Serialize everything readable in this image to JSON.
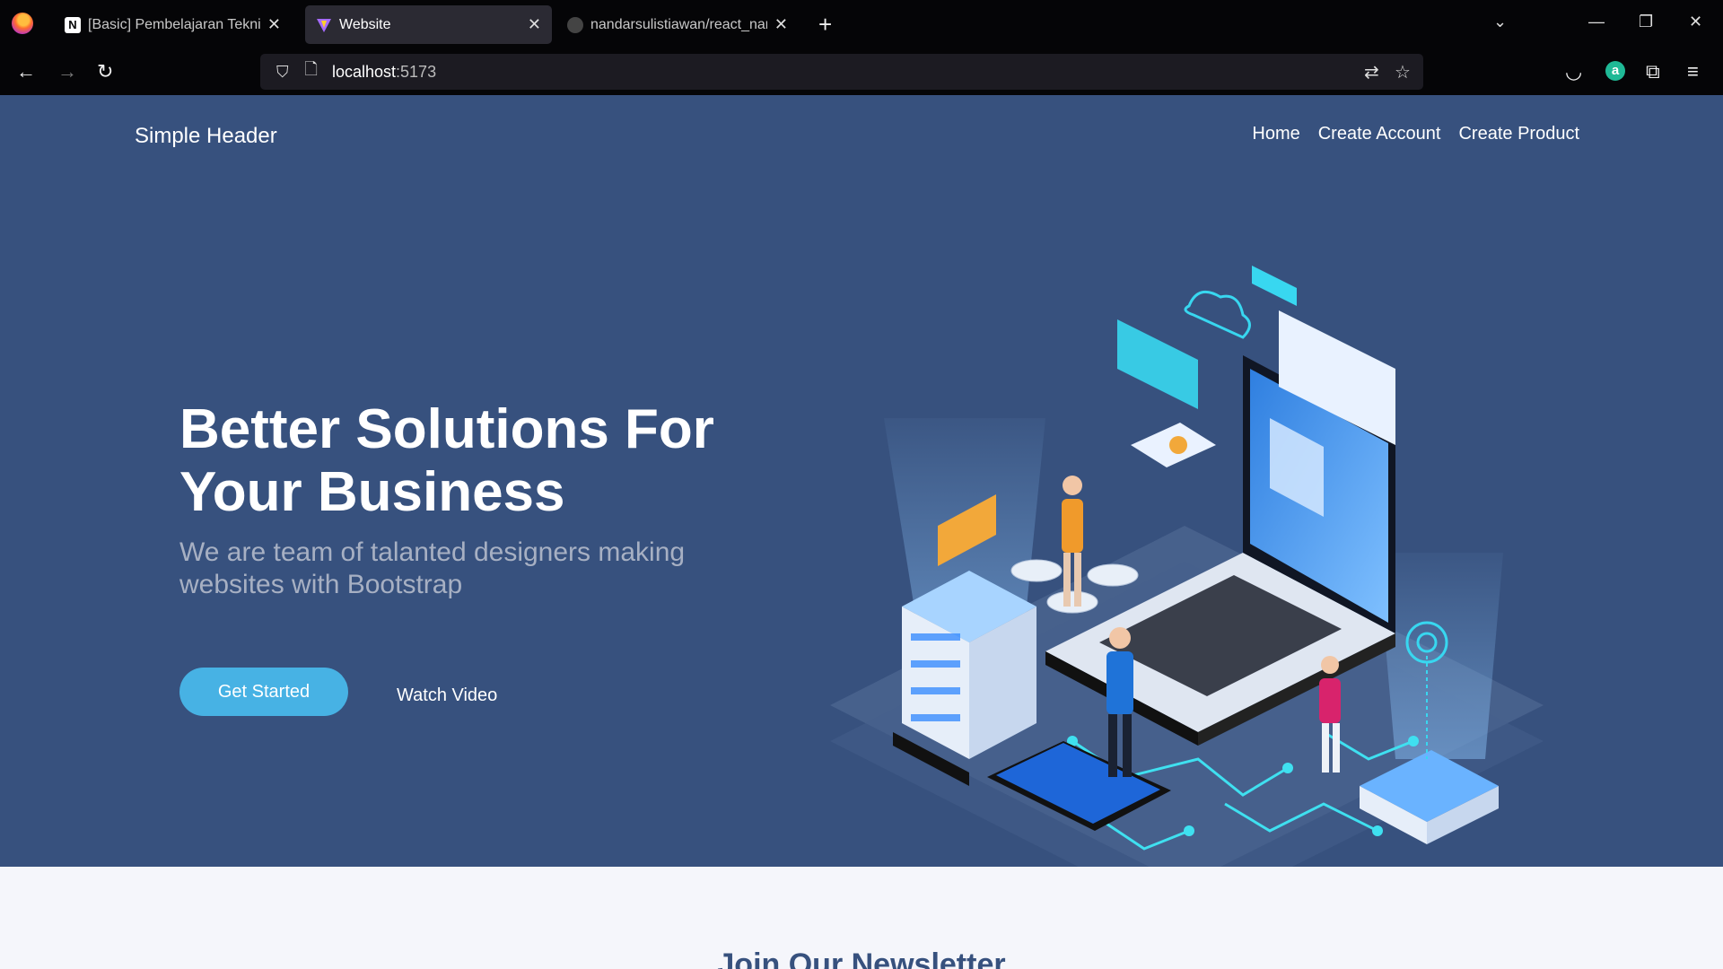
{
  "browser": {
    "tabs": [
      {
        "title": "[Basic] Pembelajaran Teknis Re",
        "favicon": "notion-icon",
        "active": false
      },
      {
        "title": "Website",
        "favicon": "vite-icon",
        "active": true
      },
      {
        "title": "nandarsulistiawan/react_nandar",
        "favicon": "github-icon",
        "active": false
      }
    ],
    "url_host": "localhost",
    "url_port": ":5173"
  },
  "header": {
    "brand": "Simple Header",
    "nav": [
      "Home",
      "Create Account",
      "Create Product"
    ]
  },
  "hero": {
    "title": "Better Solutions For Your Business",
    "subtitle": "We are team of talanted designers making websites with Bootstrap",
    "primary_button": "Get Started",
    "secondary_button": "Watch Video"
  },
  "newsletter": {
    "heading": "Join Our Newsletter"
  },
  "colors": {
    "hero_bg": "#37517e",
    "accent": "#47b2e4",
    "page_bg": "#f5f6fb"
  }
}
